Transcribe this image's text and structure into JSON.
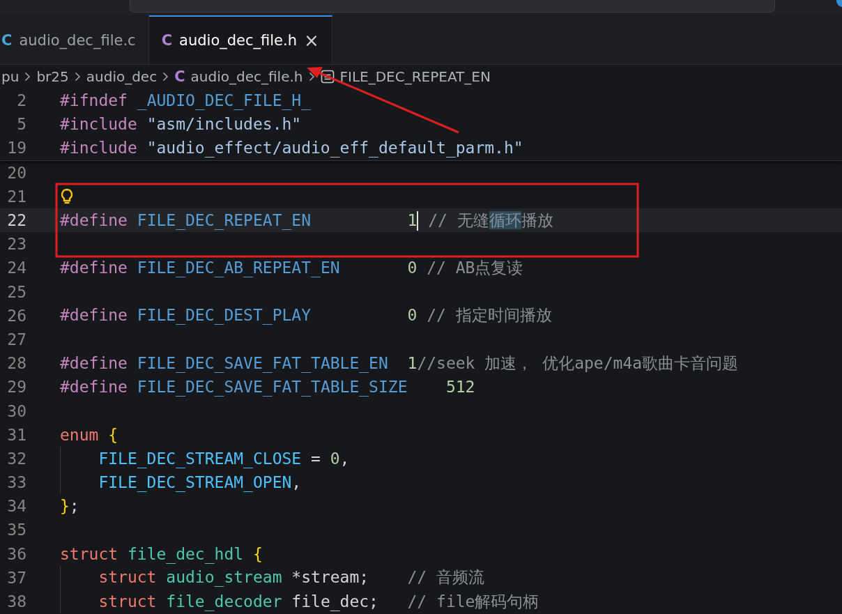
{
  "tabs": [
    {
      "label": "audio_dec_file.c",
      "icon": "C",
      "kind": "source",
      "selected": false
    },
    {
      "label": "audio_dec_file.h",
      "icon": "C",
      "kind": "header",
      "selected": true,
      "close": "×"
    }
  ],
  "breadcrumb": [
    {
      "kind": "folder",
      "label": "pu"
    },
    {
      "kind": "folder",
      "label": "br25"
    },
    {
      "kind": "folder",
      "label": "audio_dec"
    },
    {
      "kind": "file",
      "icon": "C",
      "label": "audio_dec_file.h"
    },
    {
      "kind": "symbol",
      "label": "FILE_DEC_REPEAT_EN"
    }
  ],
  "editor": {
    "lines": [
      {
        "number": "2",
        "sticky": true,
        "tokens": [
          {
            "kind": "pre",
            "t": "#ifndef "
          },
          {
            "kind": "macro",
            "t": "_AUDIO_DEC_FILE_H_"
          }
        ]
      },
      {
        "number": "5",
        "sticky": true,
        "tokens": [
          {
            "kind": "pre",
            "t": "#include "
          },
          {
            "kind": "str",
            "t": "\"asm/includes.h\""
          }
        ]
      },
      {
        "number": "19",
        "sticky": true,
        "tokens": [
          {
            "kind": "pre",
            "t": "#include "
          },
          {
            "kind": "str",
            "t": "\"audio_effect/audio_eff_default_parm.h\""
          }
        ]
      },
      {
        "number": "20"
      },
      {
        "number": "21",
        "lightbulb": true
      },
      {
        "number": "22",
        "current": true,
        "tokens": [
          {
            "kind": "pre",
            "t": "#define "
          },
          {
            "kind": "macro",
            "t": "FILE_DEC_REPEAT_EN          "
          },
          {
            "kind": "num",
            "t": "1",
            "cursor": true
          },
          {
            "kind": "com",
            "t": " // 无缝"
          },
          {
            "kind": "com",
            "t": "循环",
            "highlighted": true
          },
          {
            "kind": "com",
            "t": "播放"
          }
        ]
      },
      {
        "number": "23"
      },
      {
        "number": "24",
        "tokens": [
          {
            "kind": "pre",
            "t": "#define "
          },
          {
            "kind": "macro",
            "t": "FILE_DEC_AB_REPEAT_EN       "
          },
          {
            "kind": "num",
            "t": "0"
          },
          {
            "kind": "com",
            "t": " // AB点复读"
          }
        ]
      },
      {
        "number": "25"
      },
      {
        "number": "26",
        "tokens": [
          {
            "kind": "pre",
            "t": "#define "
          },
          {
            "kind": "macro",
            "t": "FILE_DEC_DEST_PLAY          "
          },
          {
            "kind": "num",
            "t": "0"
          },
          {
            "kind": "com",
            "t": " // 指定时间播放"
          }
        ]
      },
      {
        "number": "27"
      },
      {
        "number": "28",
        "tokens": [
          {
            "kind": "pre",
            "t": "#define "
          },
          {
            "kind": "macro",
            "t": "FILE_DEC_SAVE_FAT_TABLE_EN  "
          },
          {
            "kind": "num",
            "t": "1"
          },
          {
            "kind": "com",
            "t": "//seek 加速， 优化ape/m4a歌曲卡音问题"
          }
        ]
      },
      {
        "number": "29",
        "tokens": [
          {
            "kind": "pre",
            "t": "#define "
          },
          {
            "kind": "macro",
            "t": "FILE_DEC_SAVE_FAT_TABLE_SIZE    "
          },
          {
            "kind": "num",
            "t": "512"
          }
        ]
      },
      {
        "number": "30"
      },
      {
        "number": "31",
        "tokens": [
          {
            "kind": "kw",
            "t": "enum "
          },
          {
            "kind": "brace",
            "t": "{"
          }
        ]
      },
      {
        "number": "32",
        "tokens": [
          {
            "kind": "member",
            "t": "    FILE_DEC_STREAM_CLOSE"
          },
          {
            "kind": "plain",
            "t": " = "
          },
          {
            "kind": "num",
            "t": "0"
          },
          {
            "kind": "plain",
            "t": ","
          }
        ]
      },
      {
        "number": "33",
        "tokens": [
          {
            "kind": "member",
            "t": "    FILE_DEC_STREAM_OPEN"
          },
          {
            "kind": "plain",
            "t": ","
          }
        ]
      },
      {
        "number": "34",
        "tokens": [
          {
            "kind": "brace",
            "t": "}"
          },
          {
            "kind": "plain",
            "t": ";"
          }
        ]
      },
      {
        "number": "35"
      },
      {
        "number": "36",
        "tokens": [
          {
            "kind": "kw",
            "t": "struct "
          },
          {
            "kind": "type",
            "t": "file_dec_hdl "
          },
          {
            "kind": "brace",
            "t": "{"
          }
        ]
      },
      {
        "number": "37",
        "tokens": [
          {
            "kind": "kw",
            "t": "    struct "
          },
          {
            "kind": "type",
            "t": "audio_stream "
          },
          {
            "kind": "plain",
            "t": "*stream;    "
          },
          {
            "kind": "com",
            "t": "// 音频流"
          }
        ]
      },
      {
        "number": "38",
        "tokens": [
          {
            "kind": "kw",
            "t": "    struct "
          },
          {
            "kind": "type",
            "t": "file_decoder "
          },
          {
            "kind": "plain",
            "t": "file_dec;   "
          },
          {
            "kind": "com",
            "t": "// file解码句柄"
          }
        ]
      }
    ]
  }
}
